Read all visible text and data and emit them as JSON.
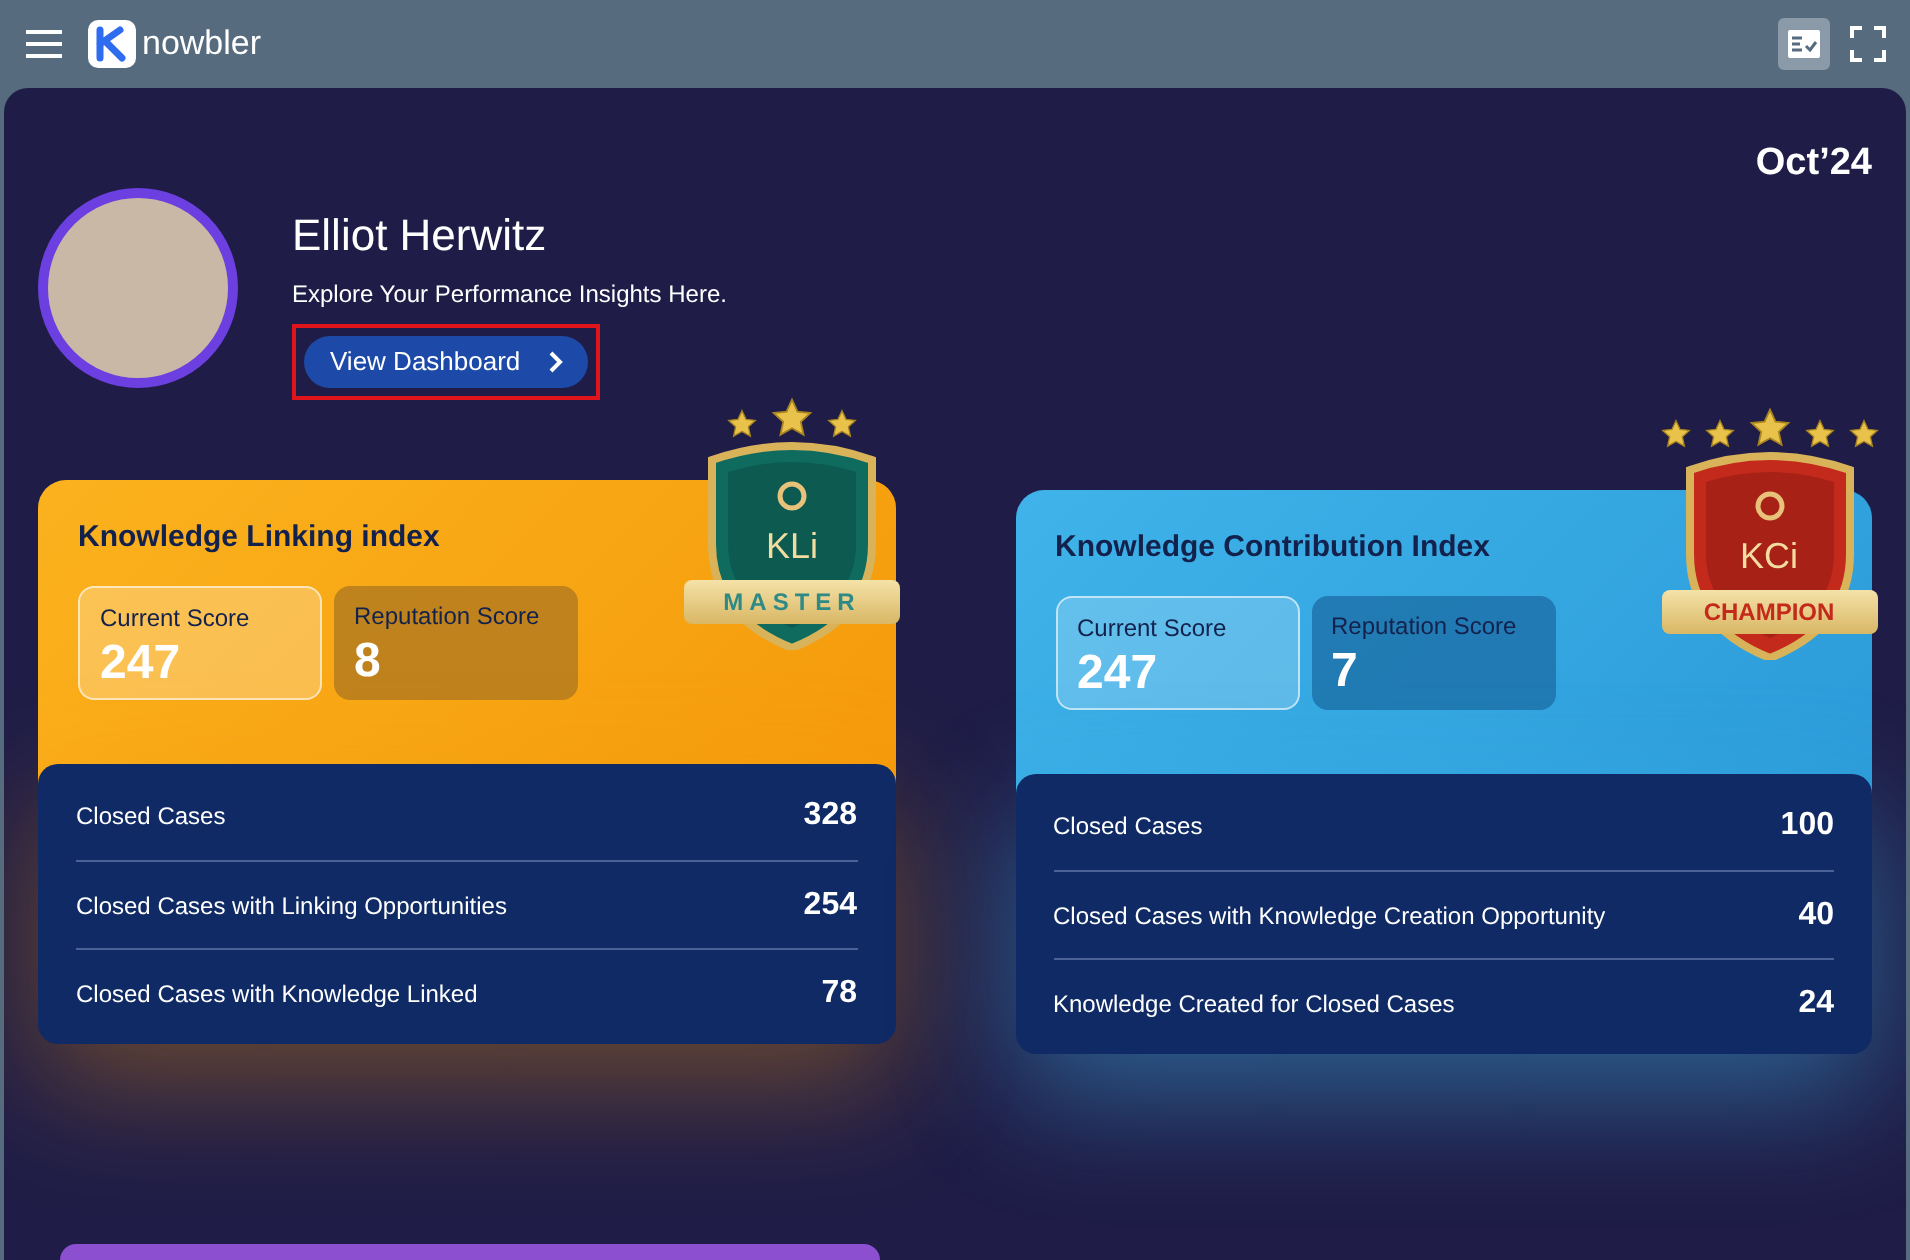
{
  "brand": {
    "name": "nowbler"
  },
  "period": "Oct’24",
  "profile": {
    "name": "Elliot Herwitz",
    "subtitle": "Explore Your Performance Insights Here.",
    "button": "View Dashboard"
  },
  "cards": [
    {
      "kind": "linking",
      "title": "Knowledge Linking index",
      "scores": [
        {
          "label": "Current Score",
          "value": "247"
        },
        {
          "label": "Reputation Score",
          "value": "8"
        }
      ],
      "badge": {
        "code": "KLi",
        "ribbon": "MASTER"
      },
      "rows": [
        {
          "label": "Closed Cases",
          "value": "328"
        },
        {
          "label": "Closed Cases with Linking Opportunities",
          "value": "254"
        },
        {
          "label": "Closed Cases with Knowledge Linked",
          "value": "78"
        }
      ]
    },
    {
      "kind": "contribution",
      "title": "Knowledge Contribution Index",
      "scores": [
        {
          "label": "Current Score",
          "value": "247"
        },
        {
          "label": "Reputation Score",
          "value": "7"
        }
      ],
      "badge": {
        "code": "KCi",
        "ribbon": "CHAMPION"
      },
      "rows": [
        {
          "label": "Closed Cases",
          "value": "100"
        },
        {
          "label": "Closed Cases with Knowledge Creation Opportunity",
          "value": "40"
        },
        {
          "label": "Knowledge Created for Closed Cases",
          "value": "24"
        }
      ]
    }
  ]
}
